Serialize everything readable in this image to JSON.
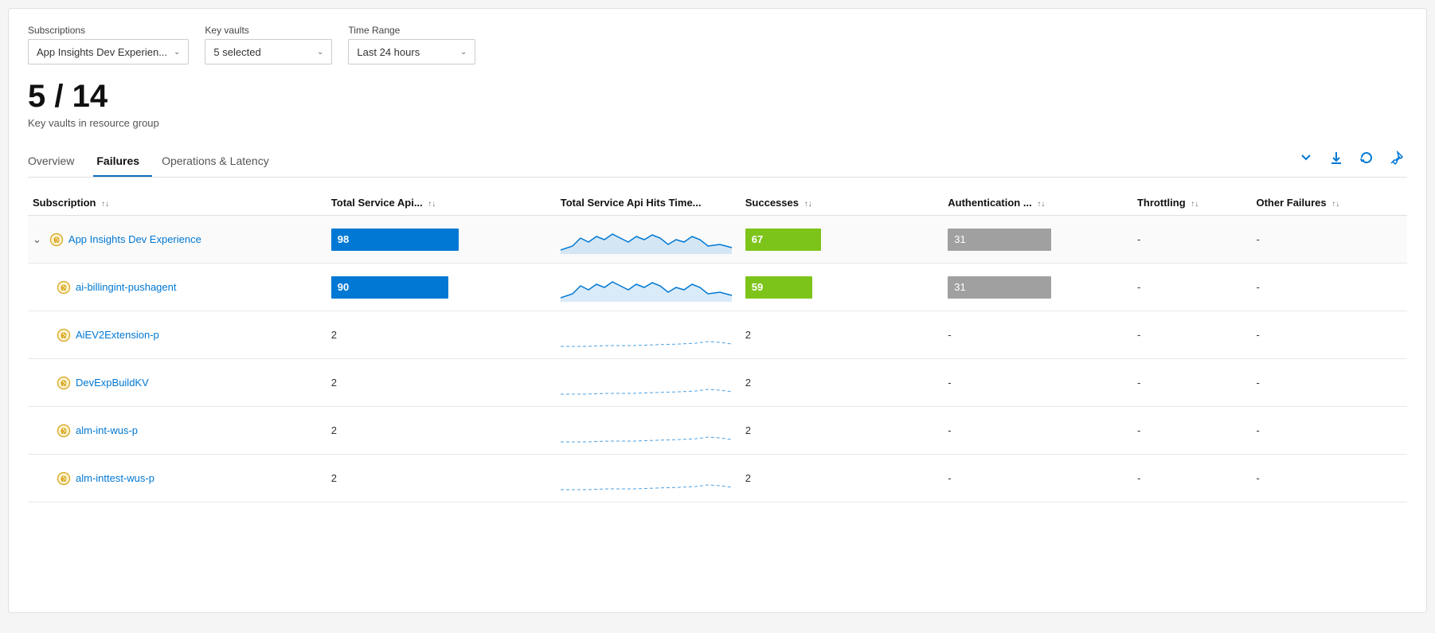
{
  "filters": {
    "subscriptions_label": "Subscriptions",
    "subscriptions_value": "App Insights Dev Experien...",
    "keyvaults_label": "Key vaults",
    "keyvaults_value": "5 selected",
    "timerange_label": "Time Range",
    "timerange_value": "Last 24 hours"
  },
  "summary": {
    "count": "5 / 14",
    "description": "Key vaults in resource group"
  },
  "tabs": [
    {
      "id": "overview",
      "label": "Overview",
      "active": false
    },
    {
      "id": "failures",
      "label": "Failures",
      "active": true
    },
    {
      "id": "operations-latency",
      "label": "Operations & Latency",
      "active": false
    }
  ],
  "tab_actions": [
    {
      "id": "expand",
      "symbol": "⌄",
      "label": "Expand"
    },
    {
      "id": "download",
      "symbol": "↓",
      "label": "Download"
    },
    {
      "id": "refresh",
      "symbol": "↺",
      "label": "Refresh"
    },
    {
      "id": "pin",
      "symbol": "📌",
      "label": "Pin"
    }
  ],
  "columns": [
    {
      "id": "subscription",
      "label": "Subscription"
    },
    {
      "id": "total-api",
      "label": "Total Service Api..."
    },
    {
      "id": "total-api-time",
      "label": "Total Service Api Hits Time..."
    },
    {
      "id": "successes",
      "label": "Successes"
    },
    {
      "id": "authentication",
      "label": "Authentication ..."
    },
    {
      "id": "throttling",
      "label": "Throttling"
    },
    {
      "id": "other-failures",
      "label": "Other Failures"
    }
  ],
  "rows": [
    {
      "id": "app-insights",
      "level": "parent",
      "name": "App Insights Dev Experience",
      "expandable": true,
      "total_api": 98,
      "total_api_bar_pct": 100,
      "total_api_bar_type": "blue",
      "successes": 67,
      "successes_bar_pct": 68,
      "successes_bar_type": "green",
      "authentication": 31,
      "authentication_bar_pct": 100,
      "authentication_bar_type": "gray",
      "throttling": "-",
      "other_failures": "-",
      "has_sparkline": true,
      "sparkline_type": "full"
    },
    {
      "id": "ai-billingint",
      "level": "child",
      "name": "ai-billingint-pushagent",
      "expandable": false,
      "total_api": 90,
      "total_api_bar_pct": 92,
      "total_api_bar_type": "blue",
      "successes": 59,
      "successes_bar_pct": 60,
      "successes_bar_type": "green",
      "authentication": 31,
      "authentication_bar_pct": 100,
      "authentication_bar_type": "gray",
      "throttling": "-",
      "other_failures": "-",
      "has_sparkline": true,
      "sparkline_type": "full"
    },
    {
      "id": "aiev2extension",
      "level": "child",
      "name": "AiEV2Extension-p",
      "expandable": false,
      "total_api": 2,
      "total_api_bar_pct": 0,
      "total_api_bar_type": "none",
      "successes": 2,
      "successes_bar_pct": 0,
      "successes_bar_type": "none",
      "authentication": "-",
      "authentication_bar_pct": 0,
      "authentication_bar_type": "none",
      "throttling": "-",
      "other_failures": "-",
      "has_sparkline": true,
      "sparkline_type": "minimal"
    },
    {
      "id": "devexpbuildkv",
      "level": "child",
      "name": "DevExpBuildKV",
      "expandable": false,
      "total_api": 2,
      "total_api_bar_pct": 0,
      "total_api_bar_type": "none",
      "successes": 2,
      "successes_bar_pct": 0,
      "successes_bar_type": "none",
      "authentication": "-",
      "authentication_bar_pct": 0,
      "authentication_bar_type": "none",
      "throttling": "-",
      "other_failures": "-",
      "has_sparkline": true,
      "sparkline_type": "minimal"
    },
    {
      "id": "alm-int-wus-p",
      "level": "child",
      "name": "alm-int-wus-p",
      "expandable": false,
      "total_api": 2,
      "total_api_bar_pct": 0,
      "total_api_bar_type": "none",
      "successes": 2,
      "successes_bar_pct": 0,
      "successes_bar_type": "none",
      "authentication": "-",
      "authentication_bar_pct": 0,
      "authentication_bar_type": "none",
      "throttling": "-",
      "other_failures": "-",
      "has_sparkline": true,
      "sparkline_type": "minimal"
    },
    {
      "id": "alm-inttest-wus-p",
      "level": "child",
      "name": "alm-inttest-wus-p",
      "expandable": false,
      "total_api": 2,
      "total_api_bar_pct": 0,
      "total_api_bar_type": "none",
      "successes": 2,
      "successes_bar_pct": 0,
      "successes_bar_type": "none",
      "authentication": "-",
      "authentication_bar_pct": 0,
      "authentication_bar_type": "none",
      "throttling": "-",
      "other_failures": "-",
      "has_sparkline": true,
      "sparkline_type": "minimal"
    }
  ]
}
